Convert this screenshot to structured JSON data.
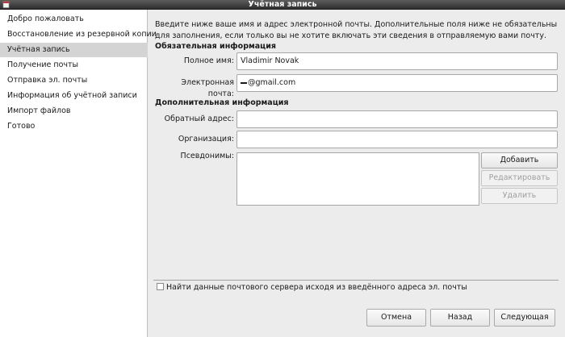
{
  "window": {
    "title": "Учётная запись",
    "app_icon": "document-icon"
  },
  "sidebar": {
    "items": [
      {
        "label": "Добро пожаловать",
        "active": false
      },
      {
        "label": "Восстановление из резервной копии",
        "active": false
      },
      {
        "label": "Учётная запись",
        "active": true
      },
      {
        "label": "Получение почты",
        "active": false
      },
      {
        "label": "Отправка эл. почты",
        "active": false
      },
      {
        "label": "Информация об учётной записи",
        "active": false
      },
      {
        "label": "Импорт файлов",
        "active": false
      },
      {
        "label": "Готово",
        "active": false
      }
    ]
  },
  "intro_text": "Введите ниже ваше имя и адрес электронной почты. Дополнительные поля ниже не обязательны для заполнения, если только вы не хотите включать эти сведения в отправляемую вами почту.",
  "required": {
    "heading": "Обязательная информация",
    "full_name": {
      "label": "Полное имя:",
      "value": "Vladimir Novak"
    },
    "email": {
      "label": "Электронная почта:",
      "value": "@gmail.com"
    }
  },
  "optional": {
    "heading": "Дополнительная информация",
    "reply_to": {
      "label": "Обратный адрес:",
      "value": ""
    },
    "organization": {
      "label": "Организация:",
      "value": ""
    },
    "aliases": {
      "label": "Псевдонимы:"
    }
  },
  "alias_buttons": {
    "add": "Добавить",
    "edit": "Редактировать",
    "remove": "Удалить"
  },
  "lookup_checkbox": {
    "label": "Найти данные почтового сервера исходя из введённого адреса эл. почты",
    "checked": false
  },
  "footer": {
    "cancel": "Отмена",
    "back": "Назад",
    "next": "Следующая"
  },
  "colors": {
    "title_bar": "#3a3a3a",
    "selected_item": "#d4d4d4",
    "separator": "#d98a8a"
  }
}
